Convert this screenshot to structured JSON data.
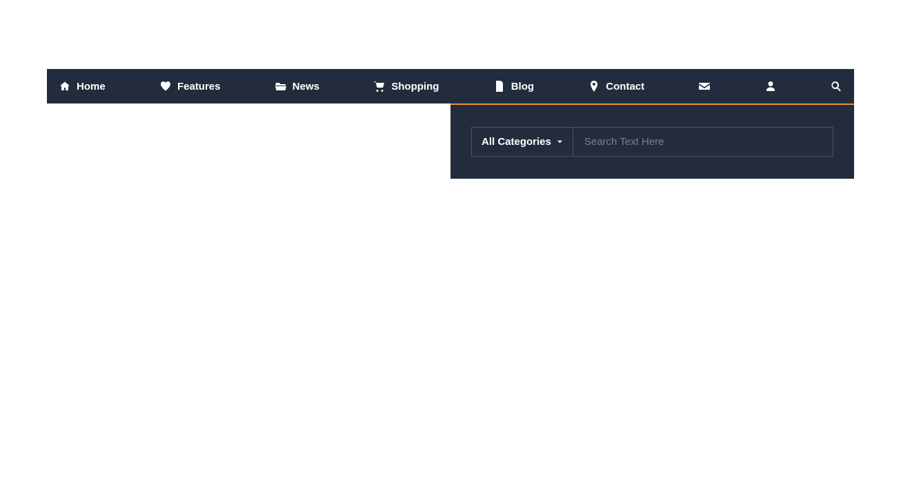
{
  "nav": {
    "items": [
      {
        "label": "Home",
        "icon": "home"
      },
      {
        "label": "Features",
        "icon": "heart"
      },
      {
        "label": "News",
        "icon": "folder"
      },
      {
        "label": "Shopping",
        "icon": "cart"
      },
      {
        "label": "Blog",
        "icon": "document"
      },
      {
        "label": "Contact",
        "icon": "pin"
      }
    ]
  },
  "search": {
    "category_label": "All Categories",
    "placeholder": "Search Text Here"
  }
}
